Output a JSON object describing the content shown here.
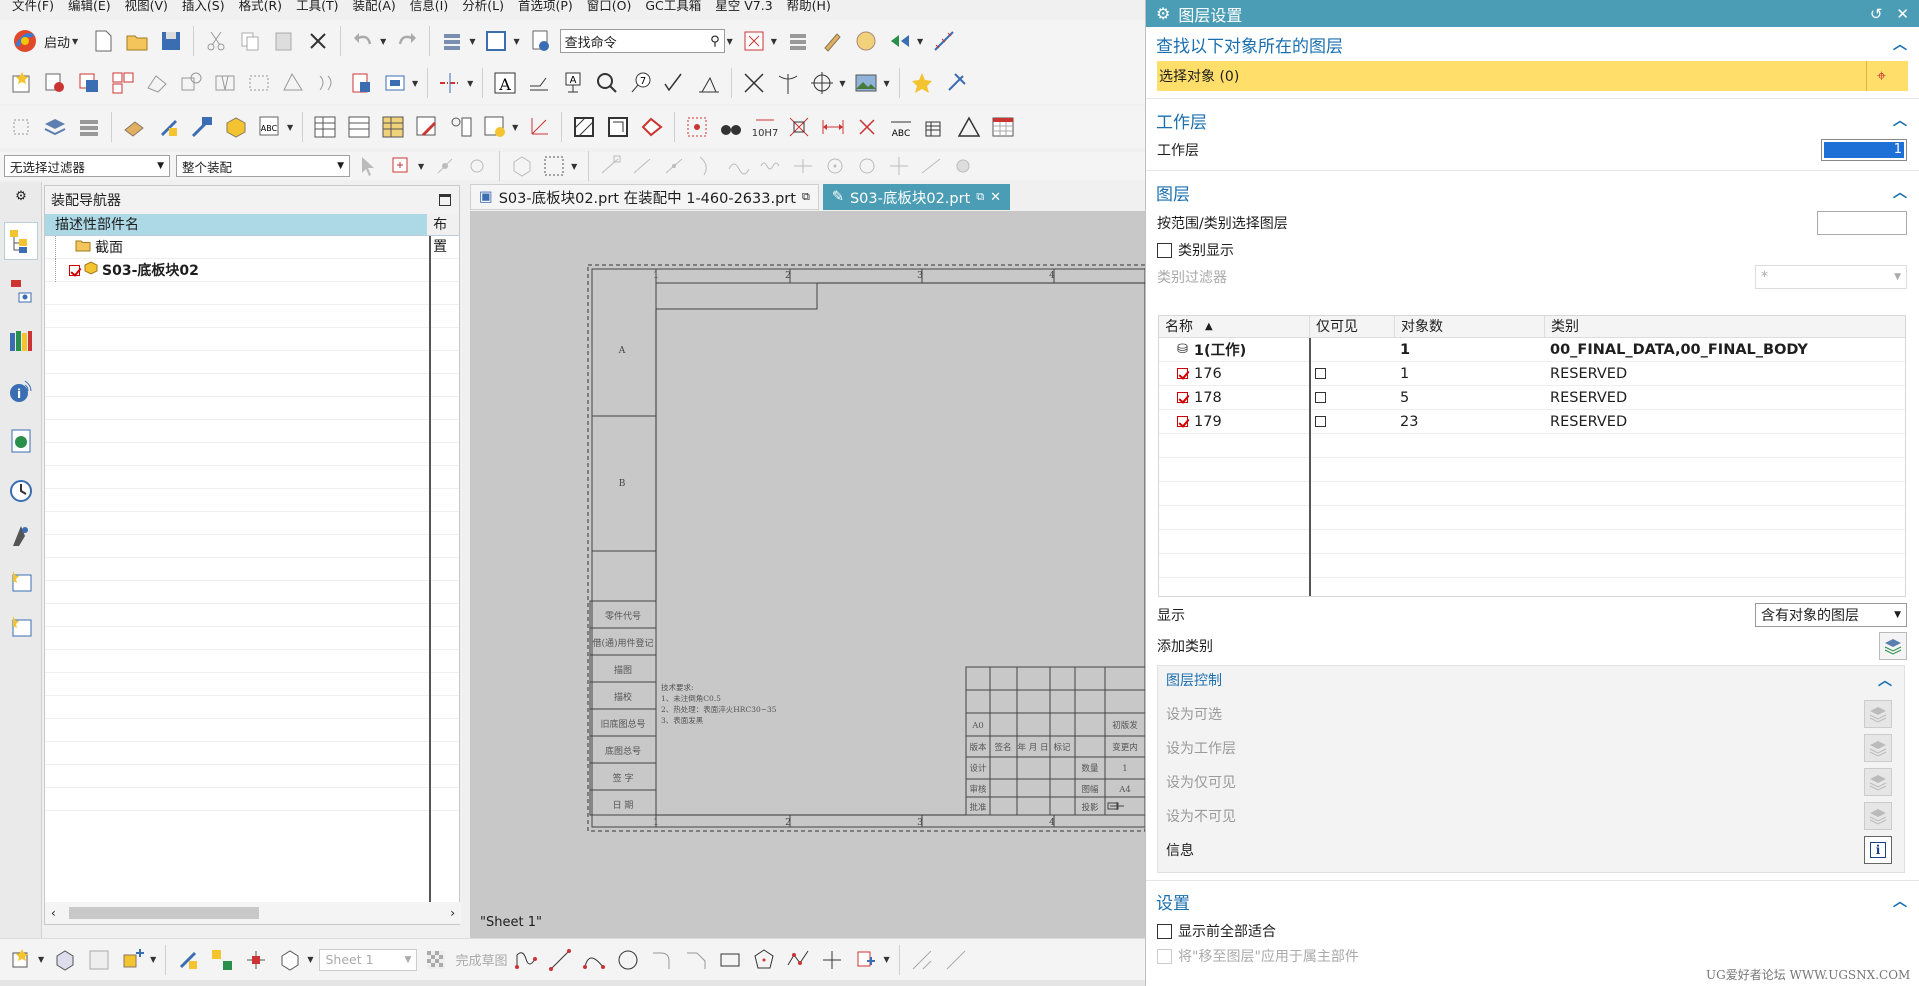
{
  "menu": [
    "文件(F)",
    "编辑(E)",
    "视图(V)",
    "插入(S)",
    "格式(R)",
    "工具(T)",
    "装配(A)",
    "信息(I)",
    "分析(L)",
    "首选项(P)",
    "窗口(O)",
    "GC工具箱",
    "星空 V7.3",
    "帮助(H)"
  ],
  "toolbar": {
    "start_label": "启动",
    "search_value": "查找命令",
    "filter_selection": "无选择过滤器",
    "filter_assembly": "整个装配",
    "sheet_select": "Sheet 1",
    "finish_sketch": "完成草图"
  },
  "navigator": {
    "title": "装配导航器",
    "col_name": "描述性部件名",
    "col_layout": "布置",
    "items": [
      {
        "label": "截面"
      },
      {
        "label": "S03-底板块02"
      }
    ]
  },
  "tabs": [
    {
      "label": "S03-底板块02.prt 在装配中 1-460-2633.prt"
    },
    {
      "label": "S03-底板块02.prt"
    }
  ],
  "canvas": {
    "sheet_label": "\"Sheet 1\"",
    "tech_notes": [
      "技术要求:",
      "1、未注倒角C0.5",
      "2、热处理：表面淬火HRC30~35",
      "3、表面发黑"
    ],
    "left_labels": [
      "零件代号",
      "借(通)用件登记",
      "描图",
      "描校",
      "旧底图总号",
      "底图总号",
      "签 字",
      "日 期"
    ],
    "title_block": [
      "A0",
      "初版发",
      "版本",
      "签名",
      "年 月 日",
      "标记",
      "变更内",
      "设计",
      "数量",
      "1",
      "审核",
      "图幅",
      "A4",
      "批准",
      "投影"
    ],
    "ruler_numbers": [
      "1",
      "2",
      "3",
      "4"
    ],
    "row_letters": [
      "A",
      "B"
    ]
  },
  "panel": {
    "title": "图层设置",
    "find_section": "查找以下对象所在的图层",
    "select_object": "选择对象 (0)",
    "work_layer_section": "工作层",
    "work_layer_label": "工作层",
    "work_layer_value": "1",
    "layer_section": "图层",
    "range_label": "按范围/类别选择图层",
    "category_display": "类别显示",
    "category_filter": "类别过滤器",
    "category_filter_value": "*",
    "grid_headers": {
      "name": "名称",
      "visible_only": "仅可见",
      "count": "对象数",
      "category": "类别"
    },
    "layers": [
      {
        "name": "1(工作)",
        "count": "1",
        "category": "00_FINAL_DATA,00_FINAL_BODY",
        "work": true
      },
      {
        "name": "176",
        "count": "1",
        "category": "RESERVED",
        "work": false
      },
      {
        "name": "178",
        "count": "5",
        "category": "RESERVED",
        "work": false
      },
      {
        "name": "179",
        "count": "23",
        "category": "RESERVED",
        "work": false
      }
    ],
    "display_label": "显示",
    "display_value": "含有对象的图层",
    "add_category": "添加类别",
    "control_section": "图层控制",
    "controls": [
      "设为可选",
      "设为工作层",
      "设为仅可见",
      "设为不可见"
    ],
    "info_label": "信息",
    "settings_section": "设置",
    "fit_all": "显示前全部适合",
    "move_layer": "将\"移至图层\"应用于属主部件"
  },
  "watermark": "UG爱好者论坛 WWW.UGSNX.COM",
  "colors": {
    "accent": "#4a9db5",
    "highlight": "#ffdf6a",
    "section_blue": "#1a6fb0",
    "nav_header": "#add8e6"
  }
}
